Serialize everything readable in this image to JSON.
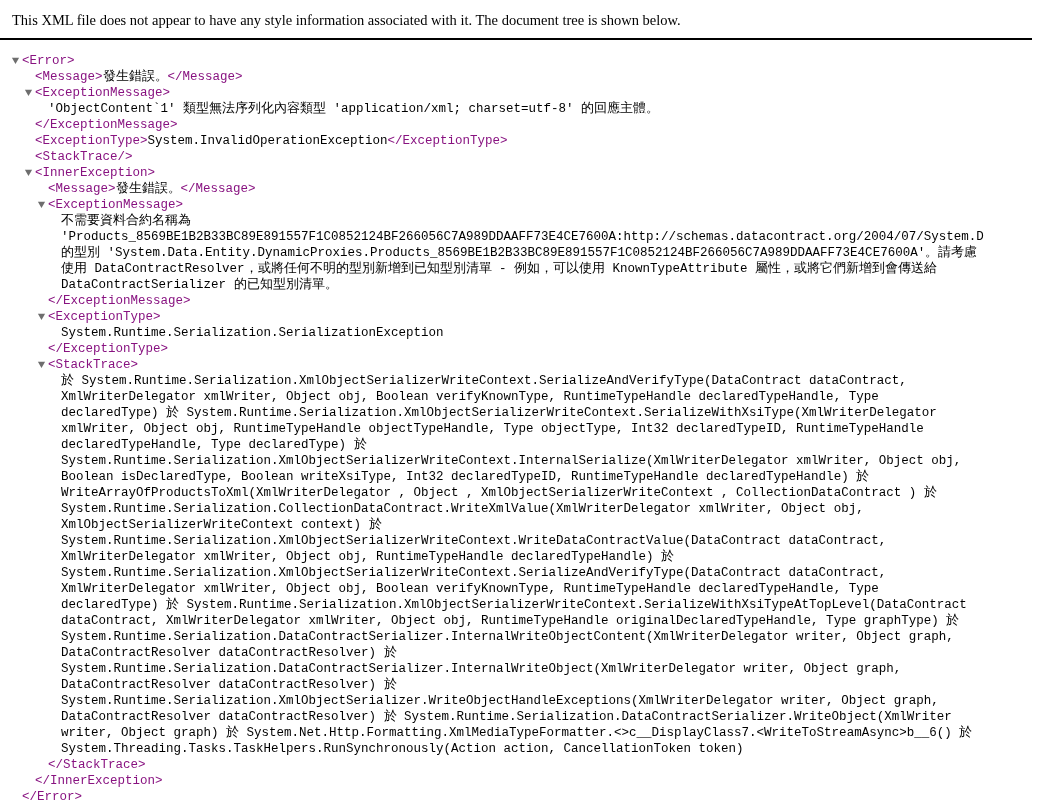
{
  "notice": "This XML file does not appear to have any style information associated with it. The document tree is shown below.",
  "tree": {
    "kind": "element",
    "open": "<Error>",
    "close": "</Error>",
    "expanded": true,
    "children": [
      {
        "kind": "inline",
        "open": "<Message>",
        "text": "發生錯誤。",
        "close": "</Message>"
      },
      {
        "kind": "element",
        "open": "<ExceptionMessage>",
        "close": "</ExceptionMessage>",
        "expanded": true,
        "text": "'ObjectContent`1' 類型無法序列化內容類型 'application/xml; charset=utf-8' 的回應主體。"
      },
      {
        "kind": "inline",
        "open": "<ExceptionType>",
        "text": "System.InvalidOperationException",
        "close": "</ExceptionType>"
      },
      {
        "kind": "empty",
        "open": "<StackTrace/>"
      },
      {
        "kind": "element",
        "open": "<InnerException>",
        "close": "</InnerException>",
        "expanded": true,
        "children": [
          {
            "kind": "inline",
            "open": "<Message>",
            "text": "發生錯誤。",
            "close": "</Message>"
          },
          {
            "kind": "element",
            "open": "<ExceptionMessage>",
            "close": "</ExceptionMessage>",
            "expanded": true,
            "text": [
              "不需要資料合約名稱為\n'Products_8569BE1B2B33BC89E891557F1C0852124BF266056C7A989DDAAFF73E4CE7600A:http://schemas.datacontract.org/2004/07/System.D\n的型別 'System.Data.Entity.DynamicProxies.Products_8569BE1B2B33BC89E891557F1C0852124BF266056C7A989DDAAFF73E4CE7600A'。請考慮",
              "使用 DataContractResolver，或將任何不明的型別新增到已知型別清單 - 例如，可以使用 KnownTypeAttribute 屬性，或將它們新增到會傳送給\nDataContractSerializer 的已知型別清單。"
            ]
          },
          {
            "kind": "element",
            "open": "<ExceptionType>",
            "close": "</ExceptionType>",
            "expanded": true,
            "text": "System.Runtime.Serialization.SerializationException"
          },
          {
            "kind": "element",
            "open": "<StackTrace>",
            "close": "</StackTrace>",
            "expanded": true,
            "text": "於 System.Runtime.Serialization.XmlObjectSerializerWriteContext.SerializeAndVerifyType(DataContract dataContract,\nXmlWriterDelegator xmlWriter, Object obj, Boolean verifyKnownType, RuntimeTypeHandle declaredTypeHandle, Type\ndeclaredType) 於 System.Runtime.Serialization.XmlObjectSerializerWriteContext.SerializeWithXsiType(XmlWriterDelegator\nxmlWriter, Object obj, RuntimeTypeHandle objectTypeHandle, Type objectType, Int32 declaredTypeID, RuntimeTypeHandle\ndeclaredTypeHandle, Type declaredType) 於\nSystem.Runtime.Serialization.XmlObjectSerializerWriteContext.InternalSerialize(XmlWriterDelegator xmlWriter, Object obj,\nBoolean isDeclaredType, Boolean writeXsiType, Int32 declaredTypeID, RuntimeTypeHandle declaredTypeHandle) 於\nWriteArrayOfProductsToXml(XmlWriterDelegator , Object , XmlObjectSerializerWriteContext , CollectionDataContract ) 於\nSystem.Runtime.Serialization.CollectionDataContract.WriteXmlValue(XmlWriterDelegator xmlWriter, Object obj,\nXmlObjectSerializerWriteContext context) 於\nSystem.Runtime.Serialization.XmlObjectSerializerWriteContext.WriteDataContractValue(DataContract dataContract,\nXmlWriterDelegator xmlWriter, Object obj, RuntimeTypeHandle declaredTypeHandle) 於\nSystem.Runtime.Serialization.XmlObjectSerializerWriteContext.SerializeAndVerifyType(DataContract dataContract,\nXmlWriterDelegator xmlWriter, Object obj, Boolean verifyKnownType, RuntimeTypeHandle declaredTypeHandle, Type\ndeclaredType) 於 System.Runtime.Serialization.XmlObjectSerializerWriteContext.SerializeWithXsiTypeAtTopLevel(DataContract\ndataContract, XmlWriterDelegator xmlWriter, Object obj, RuntimeTypeHandle originalDeclaredTypeHandle, Type graphType) 於\nSystem.Runtime.Serialization.DataContractSerializer.InternalWriteObjectContent(XmlWriterDelegator writer, Object graph,\nDataContractResolver dataContractResolver) 於\nSystem.Runtime.Serialization.DataContractSerializer.InternalWriteObject(XmlWriterDelegator writer, Object graph,\nDataContractResolver dataContractResolver) 於\nSystem.Runtime.Serialization.XmlObjectSerializer.WriteObjectHandleExceptions(XmlWriterDelegator writer, Object graph,\nDataContractResolver dataContractResolver) 於 System.Runtime.Serialization.DataContractSerializer.WriteObject(XmlWriter\nwriter, Object graph) 於 System.Net.Http.Formatting.XmlMediaTypeFormatter.<>c__DisplayClass7.<WriteToStreamAsync>b__6() 於\nSystem.Threading.Tasks.TaskHelpers.RunSynchronously(Action action, CancellationToken token)"
          }
        ]
      }
    ]
  }
}
